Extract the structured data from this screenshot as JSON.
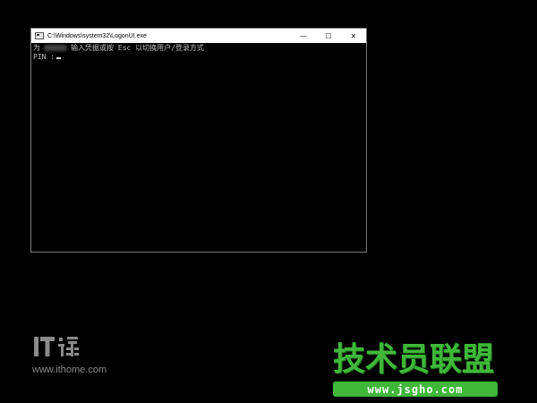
{
  "window": {
    "title": "C:\\Windows\\system32\\LogonUI.exe",
    "minimize_glyph": "—",
    "maximize_glyph": "☐",
    "close_glyph": "✕",
    "icon": "console-app-icon"
  },
  "console": {
    "line1_prefix": "为",
    "line1_suffix": "输入凭据或按 Esc 以切换用户/登录方式",
    "line2_prompt": "PIN :"
  },
  "watermarks": {
    "ithome_logo_text": "IT之家",
    "ithome_url": "www.ithome.com",
    "jsgho_title": "技术员联盟",
    "jsgho_url": "www.jsgho.com",
    "jsgho_color": "#3fb83a"
  }
}
